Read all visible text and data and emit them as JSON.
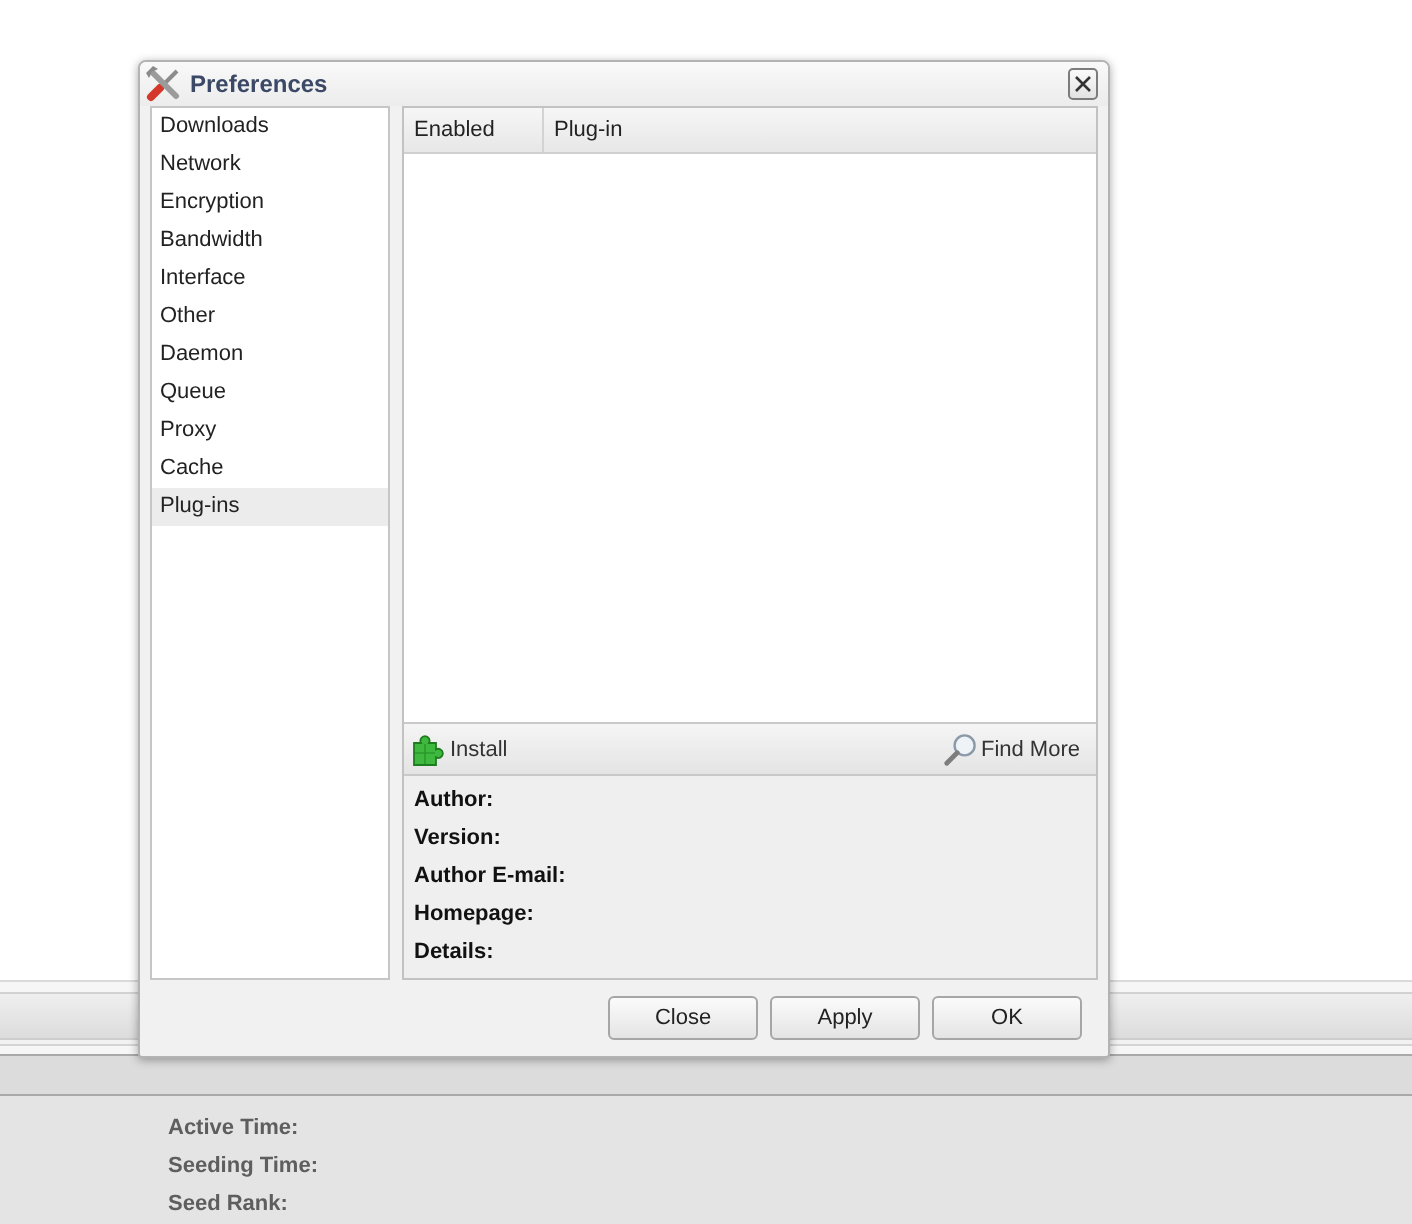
{
  "window": {
    "title": "Preferences"
  },
  "sidebar": {
    "items": [
      {
        "label": "Downloads",
        "selected": false
      },
      {
        "label": "Network",
        "selected": false
      },
      {
        "label": "Encryption",
        "selected": false
      },
      {
        "label": "Bandwidth",
        "selected": false
      },
      {
        "label": "Interface",
        "selected": false
      },
      {
        "label": "Other",
        "selected": false
      },
      {
        "label": "Daemon",
        "selected": false
      },
      {
        "label": "Queue",
        "selected": false
      },
      {
        "label": "Proxy",
        "selected": false
      },
      {
        "label": "Cache",
        "selected": false
      },
      {
        "label": "Plug-ins",
        "selected": true
      }
    ]
  },
  "plugins_table": {
    "columns": [
      "Enabled",
      "Plug-in"
    ]
  },
  "plugin_toolbar": {
    "buttons": [
      {
        "label": "Install",
        "kind": "install"
      },
      {
        "label": "Find More",
        "kind": "find"
      }
    ]
  },
  "plugin_details": {
    "labels": [
      "Author:",
      "Version:",
      "Author E-mail:",
      "Homepage:",
      "Details:"
    ]
  },
  "buttons": [
    "Close",
    "Apply",
    "OK"
  ],
  "background": {
    "labels": [
      "Active Time:",
      "Seeding Time:",
      "Seed Rank:"
    ]
  }
}
